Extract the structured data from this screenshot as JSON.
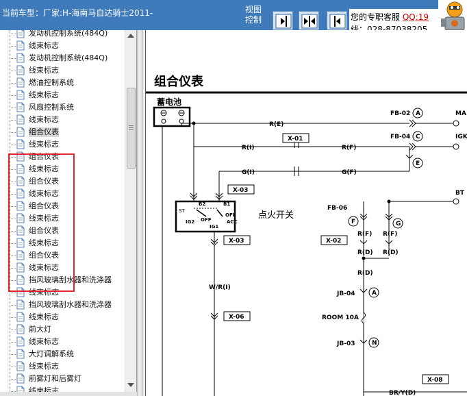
{
  "header": {
    "car_title": "当前车型：厂家:H-海南马自达骑士2011-",
    "view_control_label": "视图控制",
    "support_label": "您的专职客服",
    "qq_label": "QQ:19",
    "phone_label": "线：028-87038205",
    "view_buttons": [
      "show-right-icon",
      "expand-both-icon",
      "show-left-icon"
    ]
  },
  "tree": {
    "items": [
      {
        "label": "发动机控制系统(484Q)"
      },
      {
        "label": "线束标志"
      },
      {
        "label": "发动机控制系统(484Q)"
      },
      {
        "label": "线束标志"
      },
      {
        "label": "燃油控制系统"
      },
      {
        "label": "线束标志"
      },
      {
        "label": "风扇控制系统"
      },
      {
        "label": "线束标志"
      },
      {
        "label": "组合仪表",
        "selected": true
      },
      {
        "label": "线束标志"
      },
      {
        "label": "组合仪表"
      },
      {
        "label": "线束标志"
      },
      {
        "label": "组合仪表"
      },
      {
        "label": "线束标志"
      },
      {
        "label": "组合仪表"
      },
      {
        "label": "线束标志"
      },
      {
        "label": "组合仪表"
      },
      {
        "label": "线束标志"
      },
      {
        "label": "组合仪表"
      },
      {
        "label": "线束标志"
      },
      {
        "label": "挡风玻璃刮水器和洗涤器"
      },
      {
        "label": "线束标志"
      },
      {
        "label": "挡风玻璃刮水器和洗涤器"
      },
      {
        "label": "线束标志"
      },
      {
        "label": "前大灯"
      },
      {
        "label": "线束标志"
      },
      {
        "label": "大灯调解系统"
      },
      {
        "label": "线束标志"
      },
      {
        "label": "前雾灯和后雾灯"
      },
      {
        "label": "线束标志"
      }
    ]
  },
  "diagram": {
    "title": "组合仪表",
    "battery_label": "蓄电池",
    "ignition_label": "点火开关",
    "wires": {
      "re": "R(E)",
      "ri": "R(I)",
      "rf": "R(F)",
      "gi": "G(I)",
      "gf": "G(F)",
      "wri": "W/R(I)",
      "rf_left": "R(F)",
      "rf_right": "R(F)",
      "rd_left": "R(D)",
      "rd_right": "R(D)",
      "rd_main": "R(D)",
      "bryd": "BR/Y(D)"
    },
    "connectors": {
      "fb02": "FB-02",
      "fb04": "FB-04",
      "fb06": "FB-06",
      "x01": "X-01",
      "x02": "X-02",
      "x03_top": "X-03",
      "x03_bottom": "X-03",
      "x06": "X-06",
      "x08": "X-08",
      "jb04": "JB-04",
      "jb03": "JB-03"
    },
    "circle_marks": {
      "a1": "A",
      "c": "C",
      "e": "E",
      "f": "F",
      "g": "G",
      "a2": "A",
      "n": "N"
    },
    "right_labels": {
      "ma": "MA",
      "igk": "IGK",
      "bt": "BT"
    },
    "fuse_label": "ROOM 10A",
    "switch_labels": {
      "st": "ST",
      "b2": "B2",
      "b1": "B1",
      "ig2": "IG2",
      "off1": "OFF",
      "off2": "OFF",
      "ig1": "IG1",
      "acc": "ACC"
    }
  }
}
